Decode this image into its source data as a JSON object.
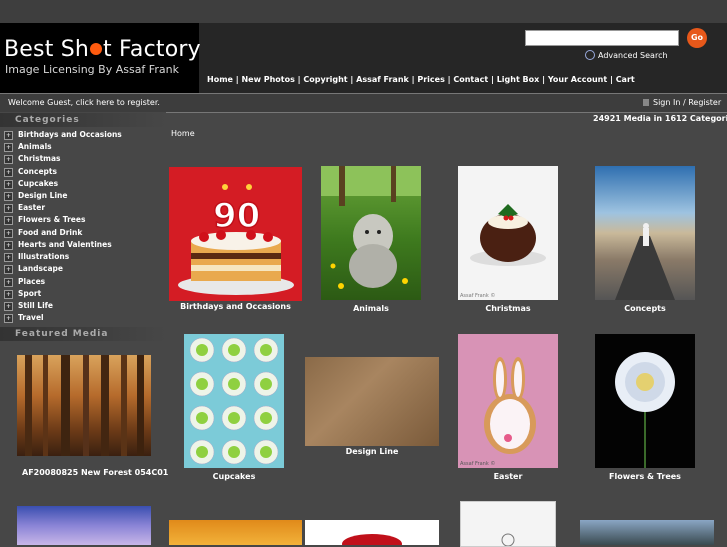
{
  "logo": {
    "title_left": "Best Sh",
    "title_right": "t Factory",
    "subtitle": "Image Licensing By Assaf Frank"
  },
  "search": {
    "value": "",
    "placeholder": "",
    "go_label": "Go",
    "advanced_label": "Advanced Search"
  },
  "nav": [
    "Home",
    "New Photos",
    "Copyright",
    "Assaf Frank",
    "Prices",
    "Contact",
    "Light Box",
    "Your Account",
    "Cart"
  ],
  "welcome": "Welcome Guest, click here to register.",
  "signin": "Sign In / Register",
  "sidebar": {
    "categories_title": "Categories",
    "categories": [
      "Birthdays and Occasions",
      "Animals",
      "Christmas",
      "Concepts",
      "Cupcakes",
      "Design Line",
      "Easter",
      "Flowers & Trees",
      "Food and Drink",
      "Hearts and Valentines",
      "Illustrations",
      "Landscape",
      "Places",
      "Sport",
      "Still Life",
      "Travel"
    ],
    "featured_title": "Featured Media",
    "featured_caption": "AF20080825 New Forest 054C01"
  },
  "stats": "24921 Media in 1612 Categories",
  "breadcrumb": "Home",
  "gallery": [
    "Birthdays and Occasions",
    "Animals",
    "Christmas",
    "Concepts",
    "Cupcakes",
    "Design Line",
    "Easter",
    "Flowers & Trees"
  ],
  "watermarks": {
    "christmas": "Assaf Frank ©",
    "easter": "Assaf Frank ©"
  },
  "cake_number": "90"
}
